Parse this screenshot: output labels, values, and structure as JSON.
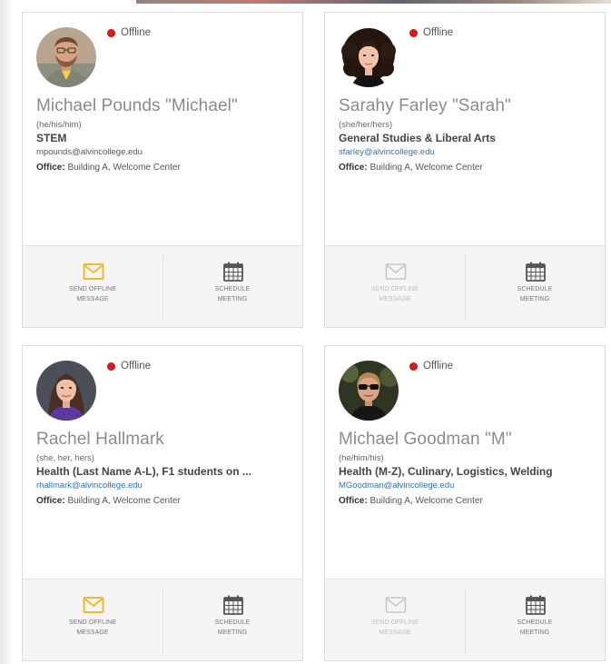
{
  "colors": {
    "status_offline": "#dd1a1a",
    "email_link": "#2f74b5",
    "message_icon_active": "#f5b731",
    "message_icon_disabled": "#c6c6c6",
    "calendar_icon": "#555555"
  },
  "cards": [
    {
      "status": "Offline",
      "name": "Michael Pounds \"Michael\"",
      "pronouns": "(he/his/him)",
      "department": "STEM",
      "email": "mpounds@alvincollege.edu",
      "office_label": "Office:",
      "office": "Building A, Welcome Center",
      "message_line1": "SEND OFFLINE",
      "message_line2": "MESSAGE",
      "message_enabled": true,
      "meeting_line1": "SCHEDULE",
      "meeting_line2": "MEETING"
    },
    {
      "status": "Offline",
      "name": "Sarahy Farley \"Sarah\"",
      "pronouns": "(she/her/hers)",
      "department": "General Studies & Liberal Arts",
      "email": "sfarley@alvincollege.edu",
      "office_label": "Office:",
      "office": "Building A, Welcome Center",
      "message_line1": "SEND OFFLINE",
      "message_line2": "MESSAGE",
      "message_enabled": false,
      "meeting_line1": "SCHEDULE",
      "meeting_line2": "MEETING"
    },
    {
      "status": "Offline",
      "name": "Rachel Hallmark",
      "pronouns": "(she, her, hers)",
      "department": "Health (Last Name A-L), F1 students on ...",
      "email": "rhallmark@alvincollege.edu",
      "office_label": "Office:",
      "office": "Building A, Welcome Center",
      "message_line1": "SEND OFFLINE",
      "message_line2": "MESSAGE",
      "message_enabled": true,
      "meeting_line1": "SCHEDULE",
      "meeting_line2": "MEETING"
    },
    {
      "status": "Offline",
      "name": "Michael Goodman \"M\"",
      "pronouns": "(he/him/his)",
      "department": "Health (M-Z), Culinary, Logistics, Welding",
      "email": "MGoodman@alvincollege.edu",
      "office_label": "Office:",
      "office": "Building A, Welcome Center",
      "message_line1": "SEND OFFLINE",
      "message_line2": "MESSAGE",
      "message_enabled": false,
      "meeting_line1": "SCHEDULE",
      "meeting_line2": "MEETING"
    }
  ]
}
